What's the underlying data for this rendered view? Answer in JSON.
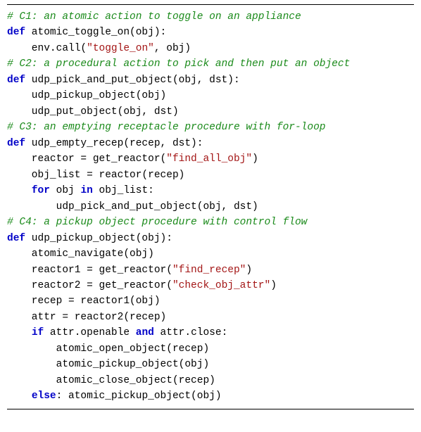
{
  "code": {
    "lines": [
      {
        "type": "comment",
        "indent": 0,
        "text": "# C1: an atomic action to toggle on an appliance"
      },
      {
        "type": "def",
        "indent": 0,
        "def": "def",
        "signature": " atomic_toggle_on(obj):"
      },
      {
        "type": "call",
        "indent": 1,
        "pre": "env.call(",
        "str": "\"toggle_on\"",
        "post": ", obj)"
      },
      {
        "type": "comment",
        "indent": 0,
        "text": "# C2: a procedural action to pick and then put an object"
      },
      {
        "type": "def",
        "indent": 0,
        "def": "def",
        "signature": " udp_pick_and_put_object(obj, dst):"
      },
      {
        "type": "plain",
        "indent": 1,
        "text": "udp_pickup_object(obj)"
      },
      {
        "type": "plain",
        "indent": 1,
        "text": "udp_put_object(obj, dst)"
      },
      {
        "type": "comment",
        "indent": 0,
        "text": "# C3: an emptying receptacle procedure with for-loop"
      },
      {
        "type": "def",
        "indent": 0,
        "def": "def",
        "signature": " udp_empty_recep(recep, dst):"
      },
      {
        "type": "call",
        "indent": 1,
        "pre": "reactor = get_reactor(",
        "str": "\"find_all_obj\"",
        "post": ")"
      },
      {
        "type": "plain",
        "indent": 1,
        "text": "obj_list = reactor(recep)"
      },
      {
        "type": "for",
        "indent": 1,
        "kw_for": "for",
        "mid": " obj ",
        "kw_in": "in",
        "post": " obj_list:"
      },
      {
        "type": "plain",
        "indent": 2,
        "text": "udp_pick_and_put_object(obj, dst)"
      },
      {
        "type": "comment",
        "indent": 0,
        "text": "# C4: a pickup object procedure with control flow"
      },
      {
        "type": "def",
        "indent": 0,
        "def": "def",
        "signature": " udp_pickup_object(obj):"
      },
      {
        "type": "plain",
        "indent": 1,
        "text": "atomic_navigate(obj)"
      },
      {
        "type": "call",
        "indent": 1,
        "pre": "reactor1 = get_reactor(",
        "str": "\"find_recep\"",
        "post": ")"
      },
      {
        "type": "call",
        "indent": 1,
        "pre": "reactor2 = get_reactor(",
        "str": "\"check_obj_attr\"",
        "post": ")"
      },
      {
        "type": "plain",
        "indent": 1,
        "text": "recep = reactor1(obj)"
      },
      {
        "type": "plain",
        "indent": 1,
        "text": "attr = reactor2(recep)"
      },
      {
        "type": "if",
        "indent": 1,
        "kw_if": "if",
        "left": " attr.openable ",
        "kw_and": "and",
        "right": " attr.close:"
      },
      {
        "type": "plain",
        "indent": 2,
        "text": "atomic_open_object(recep)"
      },
      {
        "type": "plain",
        "indent": 2,
        "text": "atomic_pickup_object(obj)"
      },
      {
        "type": "plain",
        "indent": 2,
        "text": "atomic_close_object(recep)"
      },
      {
        "type": "else",
        "indent": 1,
        "kw_else": "else",
        "post": ": atomic_pickup_object(obj)"
      }
    ]
  }
}
